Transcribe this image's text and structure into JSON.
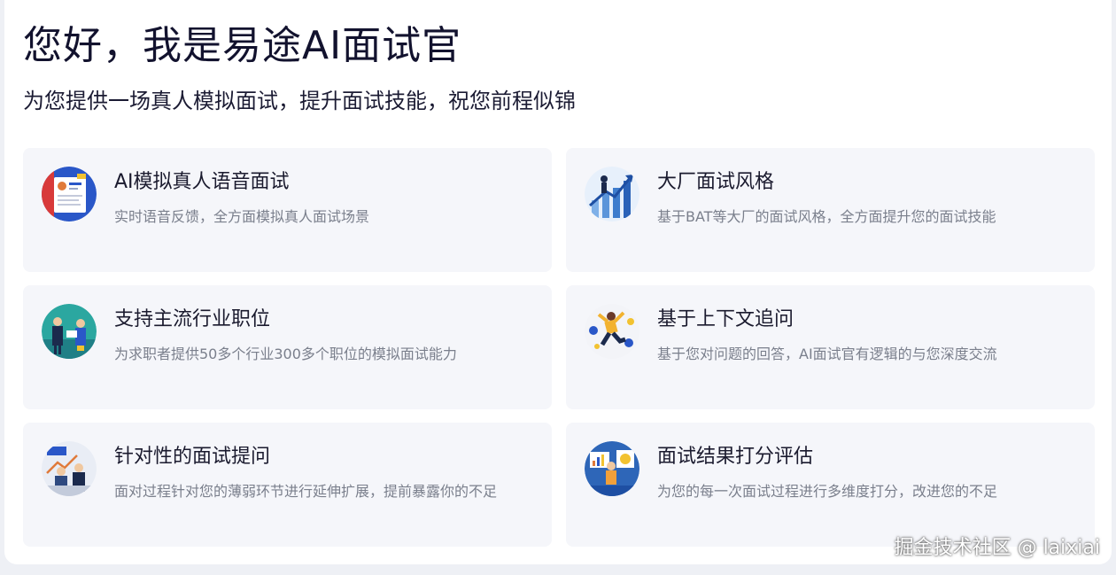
{
  "header": {
    "title": "您好，我是易途AI面试官",
    "subtitle": "为您提供一场真人模拟面试，提升面试技能，祝您前程似锦"
  },
  "features": [
    {
      "title": "AI模拟真人语音面试",
      "desc": "实时语音反馈，全方面模拟真人面试场景",
      "icon": "resume-illustration-icon"
    },
    {
      "title": "大厂面试风格",
      "desc": "基于BAT等大厂的面试风格，全方面提升您的面试技能",
      "icon": "growth-arrow-illustration-icon"
    },
    {
      "title": "支持主流行业职位",
      "desc": "为求职者提供50多个行业300多个职位的模拟面试能力",
      "icon": "business-people-illustration-icon"
    },
    {
      "title": "基于上下文追问",
      "desc": "基于您对问题的回答，AI面试官有逻辑的与您深度交流",
      "icon": "running-person-illustration-icon"
    },
    {
      "title": "针对性的面试提问",
      "desc": "面对过程针对您的薄弱环节进行延伸扩展，提前暴露你的不足",
      "icon": "meeting-illustration-icon"
    },
    {
      "title": "面试结果打分评估",
      "desc": "为您的每一次面试过程进行多维度打分，改进您的不足",
      "icon": "presentation-illustration-icon"
    }
  ],
  "watermark": "掘金技术社区 @ laixiai",
  "colors": {
    "title": "#12122e",
    "card_bg": "#f5f6fa",
    "desc": "#7a7f8c"
  }
}
